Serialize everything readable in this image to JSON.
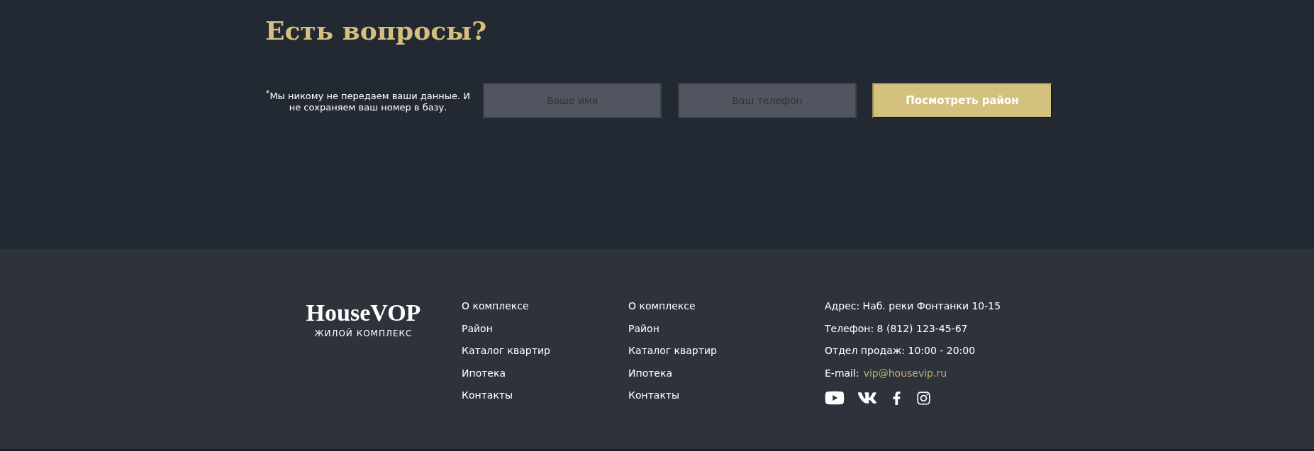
{
  "questions": {
    "title": "Есть вопросы?",
    "note": "$^{*}$Мы никому не передаем ваши данные. И не сохраняем ваш номер в базу.",
    "fields": [
      {
        "placeholder": "Ваше имя"
      },
      {
        "placeholder": "Ваш телефон"
      }
    ],
    "button": "Посмотреть район"
  },
  "footer": {
    "logo": {
      "title": "HouseVOP",
      "subtitle": "ЖИЛОЙ КОМПЛЕКС"
    },
    "menus": [
      [
        "О комплексе",
        "Район",
        "Каталог квартир",
        "Ипотека",
        "Контакты"
      ],
      [
        "О комплексе",
        "Район",
        "Каталог квартир",
        "Ипотека",
        "Контакты"
      ]
    ],
    "contacts": [
      "Адрес: Наб. реки Фонтанки 10-15",
      "Телефон: 8 (812) 123-45-67",
      "Отдел продаж: 10:00 - 20:00"
    ],
    "email": {
      "label": "E-mail:",
      "address": "vip@housevip.ru"
    },
    "social": [
      {
        "kind": "youtube"
      },
      {
        "kind": "vk"
      },
      {
        "kind": "facebook"
      },
      {
        "kind": "instagram"
      }
    ]
  }
}
